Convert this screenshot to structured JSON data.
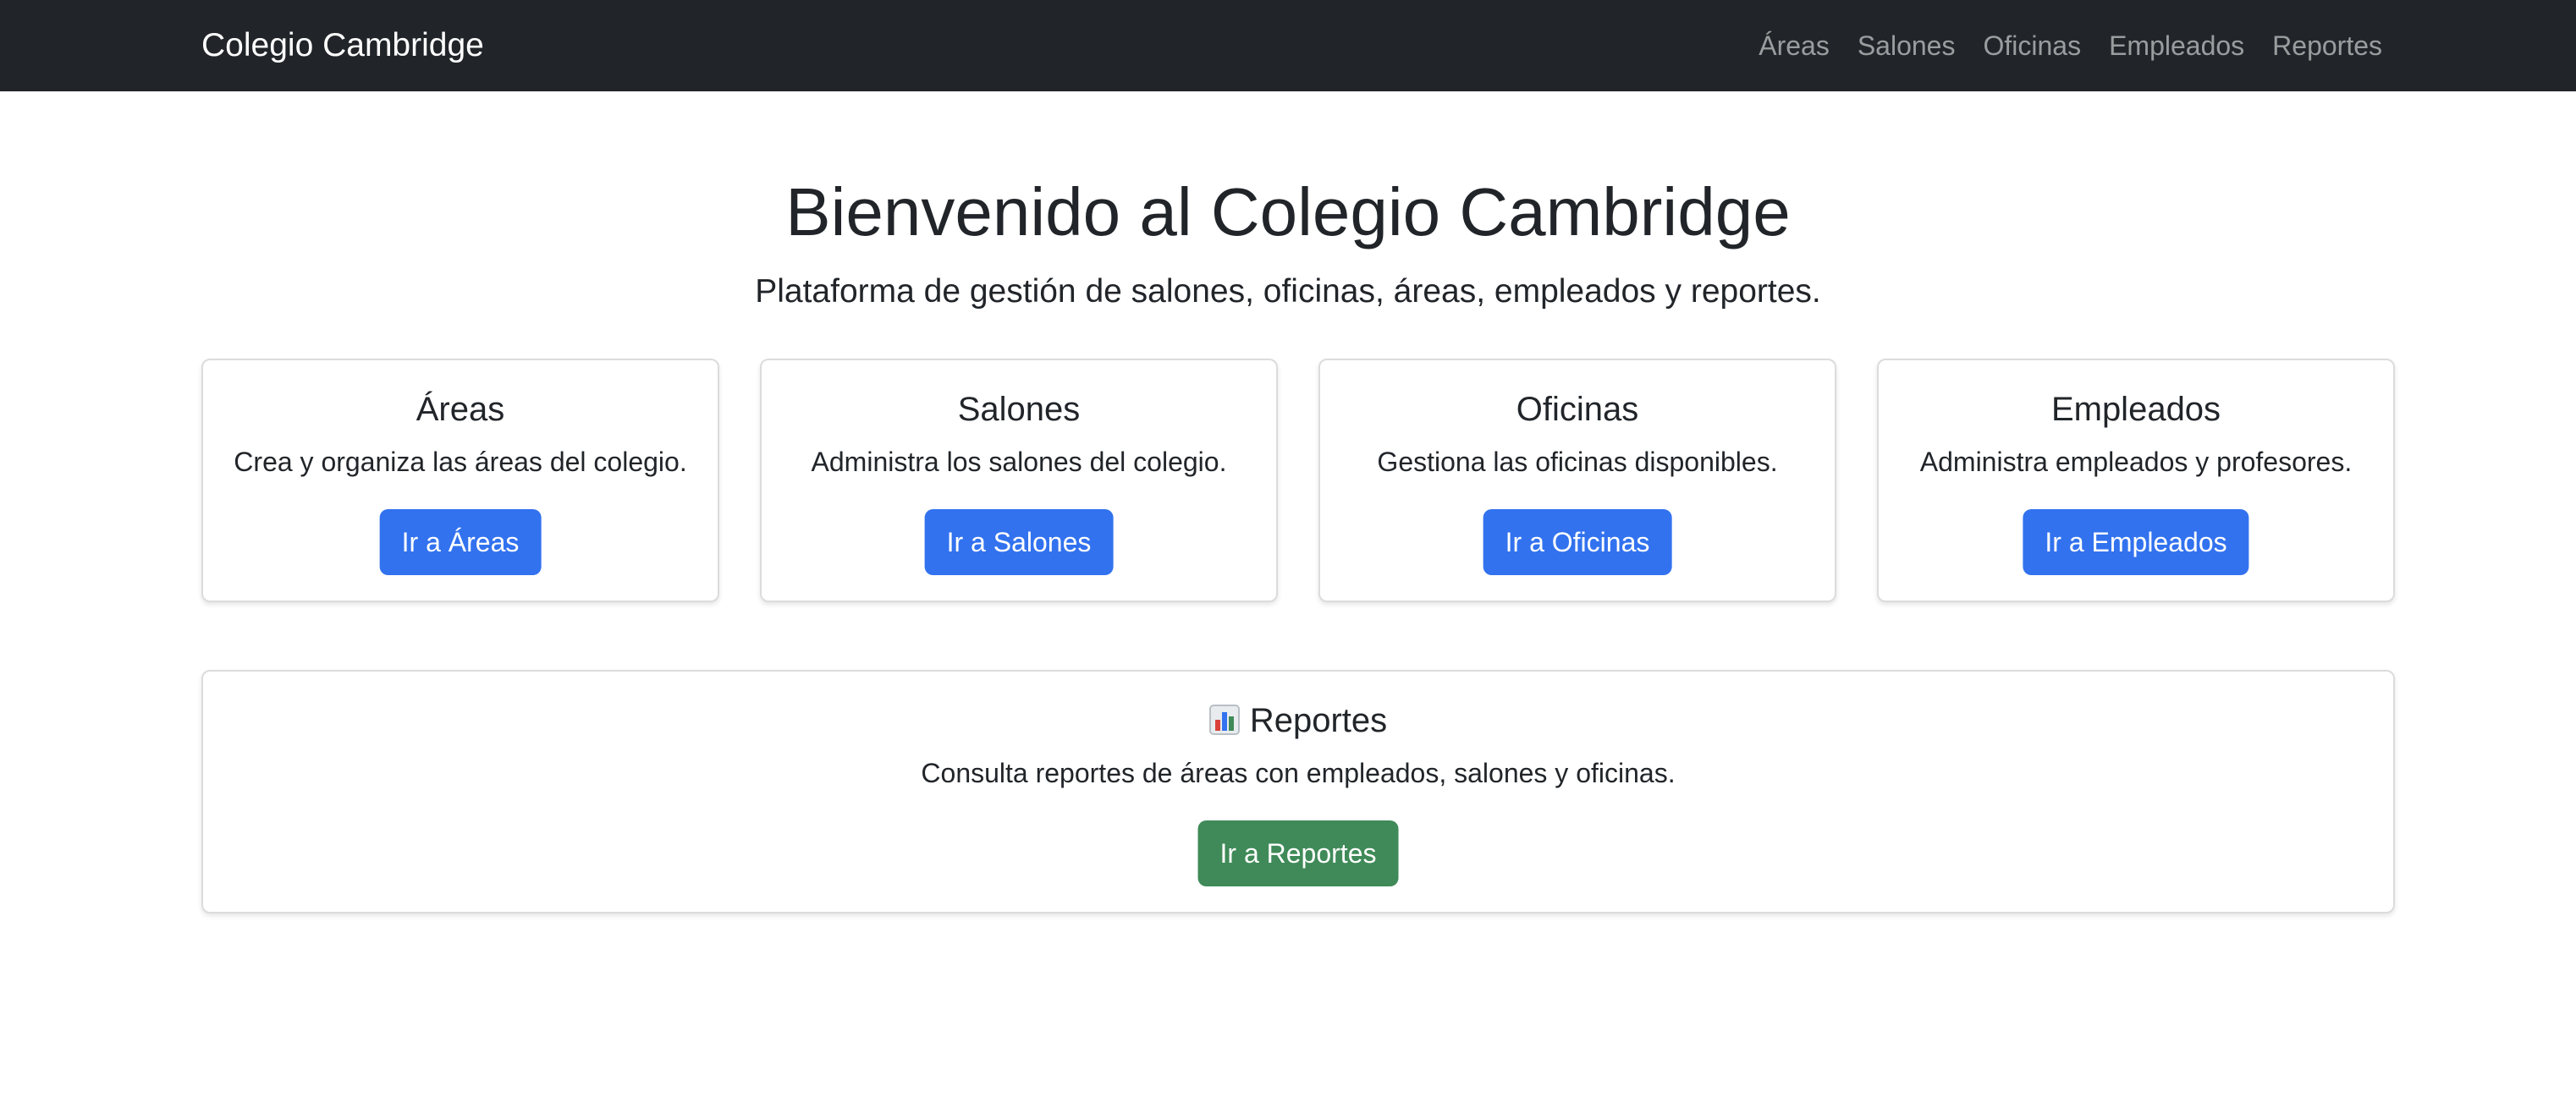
{
  "nav": {
    "brand": "Colegio Cambridge",
    "links": [
      "Áreas",
      "Salones",
      "Oficinas",
      "Empleados",
      "Reportes"
    ]
  },
  "hero": {
    "title": "Bienvenido al Colegio Cambridge",
    "subtitle": "Plataforma de gestión de salones, oficinas, áreas, empleados y reportes."
  },
  "cards": [
    {
      "title": "Áreas",
      "text": "Crea y organiza las áreas del colegio.",
      "button": "Ir a Áreas"
    },
    {
      "title": "Salones",
      "text": "Administra los salones del colegio.",
      "button": "Ir a Salones"
    },
    {
      "title": "Oficinas",
      "text": "Gestiona las oficinas disponibles.",
      "button": "Ir a Oficinas"
    },
    {
      "title": "Empleados",
      "text": "Administra empleados y profesores.",
      "button": "Ir a Empleados"
    }
  ],
  "reports": {
    "icon": "bar-chart-icon",
    "title": "Reportes",
    "text": "Consulta reportes de áreas con empleados, salones y oficinas.",
    "button": "Ir a Reportes"
  },
  "colors": {
    "navbar_bg": "#212529",
    "primary": "#3272ef",
    "success": "#3f8a58"
  }
}
